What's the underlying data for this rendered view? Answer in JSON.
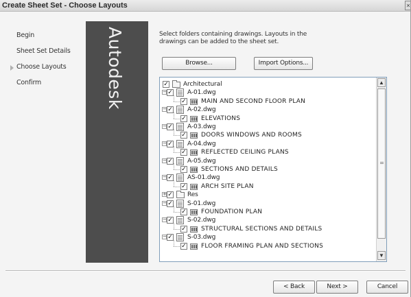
{
  "window": {
    "title": "Create Sheet Set - Choose Layouts",
    "close_glyph": "×"
  },
  "steps": [
    {
      "label": "Begin"
    },
    {
      "label": "Sheet Set Details"
    },
    {
      "label": "Choose Layouts",
      "current": true
    },
    {
      "label": "Confirm"
    }
  ],
  "brand": {
    "text": "Autodesk"
  },
  "instructions": "Select folders containing drawings. Layouts in the drawings can be added to the sheet set.",
  "buttons": {
    "browse": "Browse...",
    "import_options": "Import Options...",
    "back": "< Back",
    "next": "Next >",
    "cancel": "Cancel"
  },
  "tree": [
    {
      "level": 0,
      "type": "folder",
      "label": "Architectural",
      "checked": true,
      "expander": ""
    },
    {
      "level": 1,
      "type": "dwg",
      "label": "A-01.dwg",
      "checked": true,
      "expander": "−"
    },
    {
      "level": 2,
      "type": "layout",
      "label": "MAIN AND SECOND FLOOR PLAN",
      "checked": true,
      "expander": ""
    },
    {
      "level": 1,
      "type": "dwg",
      "label": "A-02.dwg",
      "checked": true,
      "expander": "−"
    },
    {
      "level": 2,
      "type": "layout",
      "label": "ELEVATIONS",
      "checked": true,
      "expander": ""
    },
    {
      "level": 1,
      "type": "dwg",
      "label": "A-03.dwg",
      "checked": true,
      "expander": "−"
    },
    {
      "level": 2,
      "type": "layout",
      "label": "DOORS WINDOWS AND ROOMS",
      "checked": true,
      "expander": ""
    },
    {
      "level": 1,
      "type": "dwg",
      "label": "A-04.dwg",
      "checked": true,
      "expander": "−"
    },
    {
      "level": 2,
      "type": "layout",
      "label": "REFLECTED CEILING PLANS",
      "checked": true,
      "expander": ""
    },
    {
      "level": 1,
      "type": "dwg",
      "label": "A-05.dwg",
      "checked": true,
      "expander": "−"
    },
    {
      "level": 2,
      "type": "layout",
      "label": "SECTIONS AND DETAILS",
      "checked": true,
      "expander": ""
    },
    {
      "level": 1,
      "type": "dwg",
      "label": "AS-01.dwg",
      "checked": true,
      "expander": "−"
    },
    {
      "level": 2,
      "type": "layout",
      "label": "ARCH SITE PLAN",
      "checked": true,
      "expander": ""
    },
    {
      "level": 1,
      "type": "folder",
      "label": "Res",
      "checked": true,
      "expander": "+"
    },
    {
      "level": 1,
      "type": "dwg",
      "label": "S-01.dwg",
      "checked": true,
      "expander": "−"
    },
    {
      "level": 2,
      "type": "layout",
      "label": "FOUNDATION PLAN",
      "checked": true,
      "expander": ""
    },
    {
      "level": 1,
      "type": "dwg",
      "label": "S-02.dwg",
      "checked": true,
      "expander": "−"
    },
    {
      "level": 2,
      "type": "layout",
      "label": "STRUCTURAL SECTIONS AND DETAILS",
      "checked": true,
      "expander": ""
    },
    {
      "level": 1,
      "type": "dwg",
      "label": "S-03.dwg",
      "checked": true,
      "expander": "−"
    },
    {
      "level": 2,
      "type": "layout",
      "label": "FLOOR FRAMING PLAN AND SECTIONS",
      "checked": true,
      "expander": ""
    }
  ],
  "scrollbar": {
    "up_glyph": "▲",
    "down_glyph": "▼",
    "grip_glyph": "≡"
  },
  "colors": {
    "brand_panel": "#4d4d4d",
    "window_bg": "#f4f4f4",
    "tree_border": "#7f9db9"
  }
}
